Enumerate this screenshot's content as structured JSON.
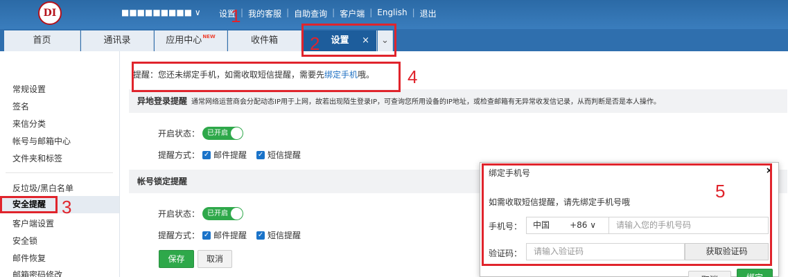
{
  "header": {
    "logo_text": "DI",
    "user_email": "■■■■■■■■■ ∨",
    "nav": [
      "设置",
      "我的客服",
      "自助查询",
      "客户端",
      "English",
      "退出"
    ]
  },
  "tabs": [
    {
      "label": "首页"
    },
    {
      "label": "通讯录"
    },
    {
      "label": "应用中心",
      "badge": "NEW"
    },
    {
      "label": "收件箱"
    },
    {
      "label": "设置",
      "close": "×"
    }
  ],
  "tab_dropdown": "⌄",
  "sidebar": {
    "items": [
      "常规设置",
      "签名",
      "来信分类",
      "帐号与邮箱中心",
      "文件夹和标签",
      "反垃圾/黑白名单",
      "安全提醒",
      "客户端设置",
      "安全锁",
      "邮件恢复",
      "邮箱密码修改"
    ]
  },
  "notice": {
    "prefix": "提醒：您还未绑定手机，如需收取短信提醒，需要先",
    "link": "绑定手机",
    "suffix": "哦。"
  },
  "section1": {
    "title": "异地登录提醒",
    "desc": "通常网络运营商会分配动态IP用于上网，故若出现陌生登录IP，可查询您所用设备的IP地址，或检查邮箱有无异常收发信记录，从而判断是否是本人操作。",
    "status_label": "开启状态：",
    "toggle": "已开启",
    "method_label": "提醒方式：",
    "mail": "邮件提醒",
    "sms": "短信提醒"
  },
  "section2": {
    "title": "帐号锁定提醒",
    "status_label": "开启状态：",
    "toggle": "已开启",
    "method_label": "提醒方式：",
    "mail": "邮件提醒",
    "sms": "短信提醒",
    "save": "保存",
    "cancel": "取消"
  },
  "dialog": {
    "title": "绑定手机号",
    "close": "×",
    "message": "如需收取短信提醒，请先绑定手机号哦",
    "phone_label": "手机号：",
    "country": "中国",
    "code": "+86 ∨",
    "phone_placeholder": "请输入您的手机号码",
    "code_label": "验证码：",
    "code_placeholder": "请输入验证码",
    "get_code": "获取验证码",
    "cancel": "取消",
    "bind": "绑定"
  },
  "annotations": [
    "1",
    "2",
    "3",
    "4",
    "5"
  ],
  "colors": {
    "accent": "#2f6fae",
    "green": "#2ea84a",
    "annotation": "#e0242c",
    "link": "#1d6fc2"
  }
}
